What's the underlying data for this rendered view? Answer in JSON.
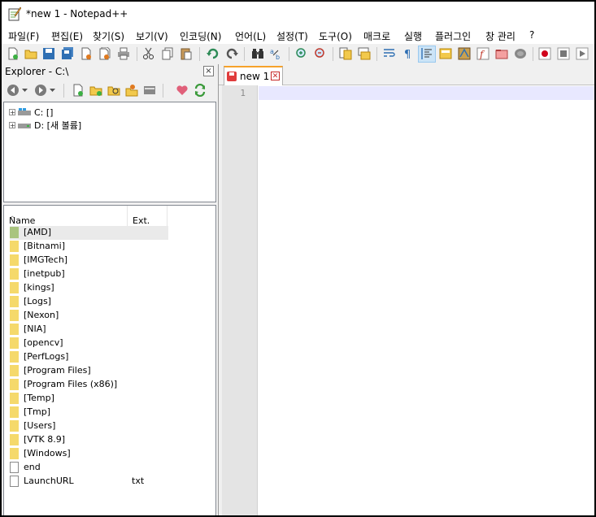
{
  "app": {
    "title": "*new 1 - Notepad++"
  },
  "menu": [
    "파일(F)",
    "편집(E)",
    "찾기(S)",
    "보기(V)",
    "인코딩(N)",
    "언어(L)",
    "설정(T)",
    "도구(O)",
    "매크로",
    "실행",
    "플러그인",
    "창 관리",
    "?"
  ],
  "explorer": {
    "title": "Explorer - C:\\",
    "close": "×",
    "tree": [
      {
        "label": "C: []",
        "expander": "+"
      },
      {
        "label": "D: [새 볼륨]",
        "expander": "+"
      }
    ],
    "columns": {
      "name": "Name",
      "ext": "Ext.",
      "sort_glyph": "^"
    },
    "files": [
      {
        "name": "[AMD]",
        "ext": "",
        "type": "folder",
        "selected": true
      },
      {
        "name": "[Bitnami]",
        "ext": "",
        "type": "folder"
      },
      {
        "name": "[IMGTech]",
        "ext": "",
        "type": "folder"
      },
      {
        "name": "[inetpub]",
        "ext": "",
        "type": "folder"
      },
      {
        "name": "[kings]",
        "ext": "",
        "type": "folder"
      },
      {
        "name": "[Logs]",
        "ext": "",
        "type": "folder"
      },
      {
        "name": "[Nexon]",
        "ext": "",
        "type": "folder"
      },
      {
        "name": "[NIA]",
        "ext": "",
        "type": "folder"
      },
      {
        "name": "[opencv]",
        "ext": "",
        "type": "folder"
      },
      {
        "name": "[PerfLogs]",
        "ext": "",
        "type": "folder"
      },
      {
        "name": "[Program Files]",
        "ext": "",
        "type": "folder"
      },
      {
        "name": "[Program Files (x86)]",
        "ext": "",
        "type": "folder"
      },
      {
        "name": "[Temp]",
        "ext": "",
        "type": "folder"
      },
      {
        "name": "[Tmp]",
        "ext": "",
        "type": "folder"
      },
      {
        "name": "[Users]",
        "ext": "",
        "type": "folder"
      },
      {
        "name": "[VTK 8.9]",
        "ext": "",
        "type": "folder"
      },
      {
        "name": "[Windows]",
        "ext": "",
        "type": "folder"
      },
      {
        "name": "end",
        "ext": "",
        "type": "file"
      },
      {
        "name": "LaunchURL",
        "ext": "txt",
        "type": "file"
      }
    ]
  },
  "editor": {
    "tab_label": "new 1",
    "line_number": "1"
  },
  "colors": {
    "folder": "#f5d96b",
    "selected_folder": "#a9c47f",
    "current_line": "#e8e8ff",
    "tab_accent": "#f6a22a"
  }
}
